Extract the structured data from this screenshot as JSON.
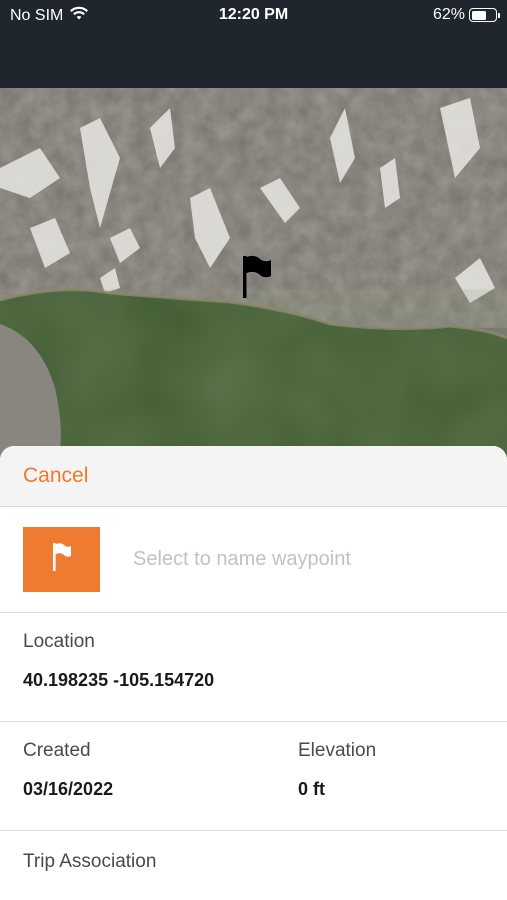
{
  "status": {
    "carrier": "No SIM",
    "time": "12:20 PM",
    "battery_text": "62%",
    "battery_level": 0.62
  },
  "map": {
    "marker_icon": "flag-icon"
  },
  "sheet": {
    "cancel_label": "Cancel",
    "name_placeholder": "Select to name waypoint",
    "location_label": "Location",
    "location_value": "40.198235 -105.154720",
    "created_label": "Created",
    "created_value": "03/16/2022",
    "elevation_label": "Elevation",
    "elevation_value": "0 ft",
    "trip_label": "Trip Association"
  },
  "colors": {
    "accent": "#ee7b30",
    "status_bar": "#1f262e",
    "water": "#3f5a33"
  }
}
